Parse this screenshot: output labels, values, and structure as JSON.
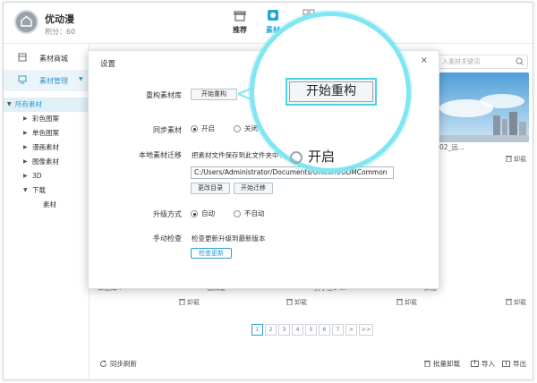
{
  "header": {
    "app_name": "优动漫",
    "points": "积分：60",
    "tabs": [
      {
        "label": "推荐",
        "icon": "gift-box-icon"
      },
      {
        "label": "素材",
        "icon": "material-icon",
        "active": true
      },
      {
        "label": "",
        "icon": "grid-icon"
      }
    ]
  },
  "sidebar": {
    "items": [
      {
        "label": "素材商城",
        "icon": "store-icon"
      },
      {
        "label": "素材管理",
        "icon": "monitor-icon",
        "active": true
      }
    ],
    "tree": [
      {
        "label": "所有素材",
        "root": true
      },
      {
        "label": "彩色图案"
      },
      {
        "label": "单色图案"
      },
      {
        "label": "漫画素材"
      },
      {
        "label": "图像素材"
      },
      {
        "label": "3D"
      },
      {
        "label": "下载"
      },
      {
        "label": "素材",
        "child": true
      }
    ]
  },
  "content": {
    "search_placeholder": "入素材关键词",
    "thumb_name": "02_远...",
    "download_label": "卸载",
    "row_labels": [
      "二铅海A",
      "饱和量",
      "男子主0-V..",
      "斜描"
    ],
    "pager": [
      "1",
      "2",
      "3",
      "4",
      "5",
      "6",
      "7",
      ">",
      ">>"
    ],
    "footer": {
      "sync_refresh": "同步刷新",
      "batch_uninstall": "批量卸载",
      "import": "导入",
      "export": "导出"
    }
  },
  "dialog": {
    "title": "设置",
    "close": "×",
    "rebuild_label": "重构素材库",
    "rebuild_button": "开始重构",
    "sync_label": "同步素材",
    "sync_on": "开启",
    "sync_off": "关闭",
    "local_migrate_label": "本地素材迁移",
    "migrate_hint": "把素材文件保存到此文件夹中：",
    "migrate_path": "C:/Users/Administrator/Documents/Unicorn/UDMCommon",
    "change_dir_button": "更改目录",
    "start_migrate_button": "开始迁移",
    "upgrade_label": "升级方式",
    "upgrade_auto": "自动",
    "upgrade_manual": "不自动",
    "manual_check_label": "手动检查",
    "check_hint": "检查更新升级到最新版本",
    "check_button": "检查更新"
  },
  "magnifier": {
    "button": "开始重构",
    "radio_label": "开启"
  },
  "colors": {
    "accent": "#2d9bd0",
    "callout_ring": "#7fe6f2"
  }
}
